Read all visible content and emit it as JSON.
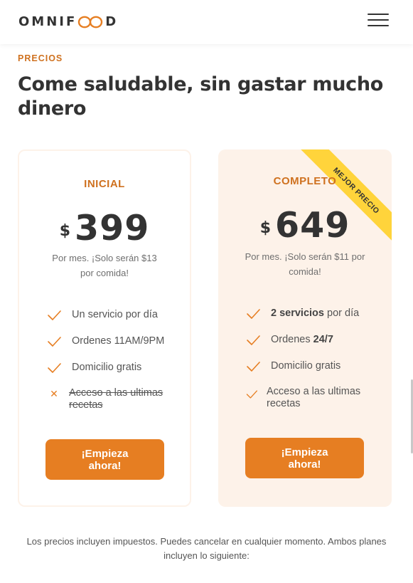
{
  "header": {
    "logo_pre": "OMNIF",
    "logo_post": "D",
    "logo_mark_color": "#e67e22"
  },
  "section": {
    "eyebrow": "PRECIOS",
    "heading_line1": "Come saludable, sin gastar mucho",
    "heading_line2": "dinero"
  },
  "plans": [
    {
      "name": "INICIAL",
      "currency": "$",
      "amount": "399",
      "note_line1": "Por mes. ¡Solo serán $13",
      "note_line2": "por comida!",
      "features": [
        {
          "text": "Un servicio por día"
        },
        {
          "text": "Ordenes 11AM/9PM"
        },
        {
          "text": "Domicilio gratis"
        },
        {
          "text_line1": "Acceso a las ultimas",
          "text_line2": "recetas",
          "excluded": true
        }
      ],
      "cta_line1": "¡Empieza",
      "cta_line2": "ahora!"
    },
    {
      "name": "COMPLETO",
      "ribbon": "MEJOR PRECIO",
      "currency": "$",
      "amount": "649",
      "note_line1": "Por mes. ¡Solo serán $11 por",
      "note_line2": "comida!",
      "features": [
        {
          "bold": "2 servicios",
          "rest": " por día"
        },
        {
          "rest": "Ordenes ",
          "bold": "24/7"
        },
        {
          "text": "Domicilio gratis"
        },
        {
          "text_line1": "Acceso a las ultimas",
          "text_line2": "recetas"
        }
      ],
      "cta_line1": "¡Empieza",
      "cta_line2": "ahora!"
    }
  ],
  "footnote_line1": "Los precios incluyen impuestos. Puedes cancelar en cualquier momento. Ambos planes",
  "footnote_line2": "incluyen lo siguiente:",
  "colors": {
    "accent": "#e67e22",
    "accent_dark": "#cf711f",
    "card_tint": "#fdf2e9",
    "ribbon": "#ffd43b"
  },
  "icons": {
    "menu": "menu-icon",
    "check": "checkmark-icon",
    "cross": "close-icon"
  }
}
